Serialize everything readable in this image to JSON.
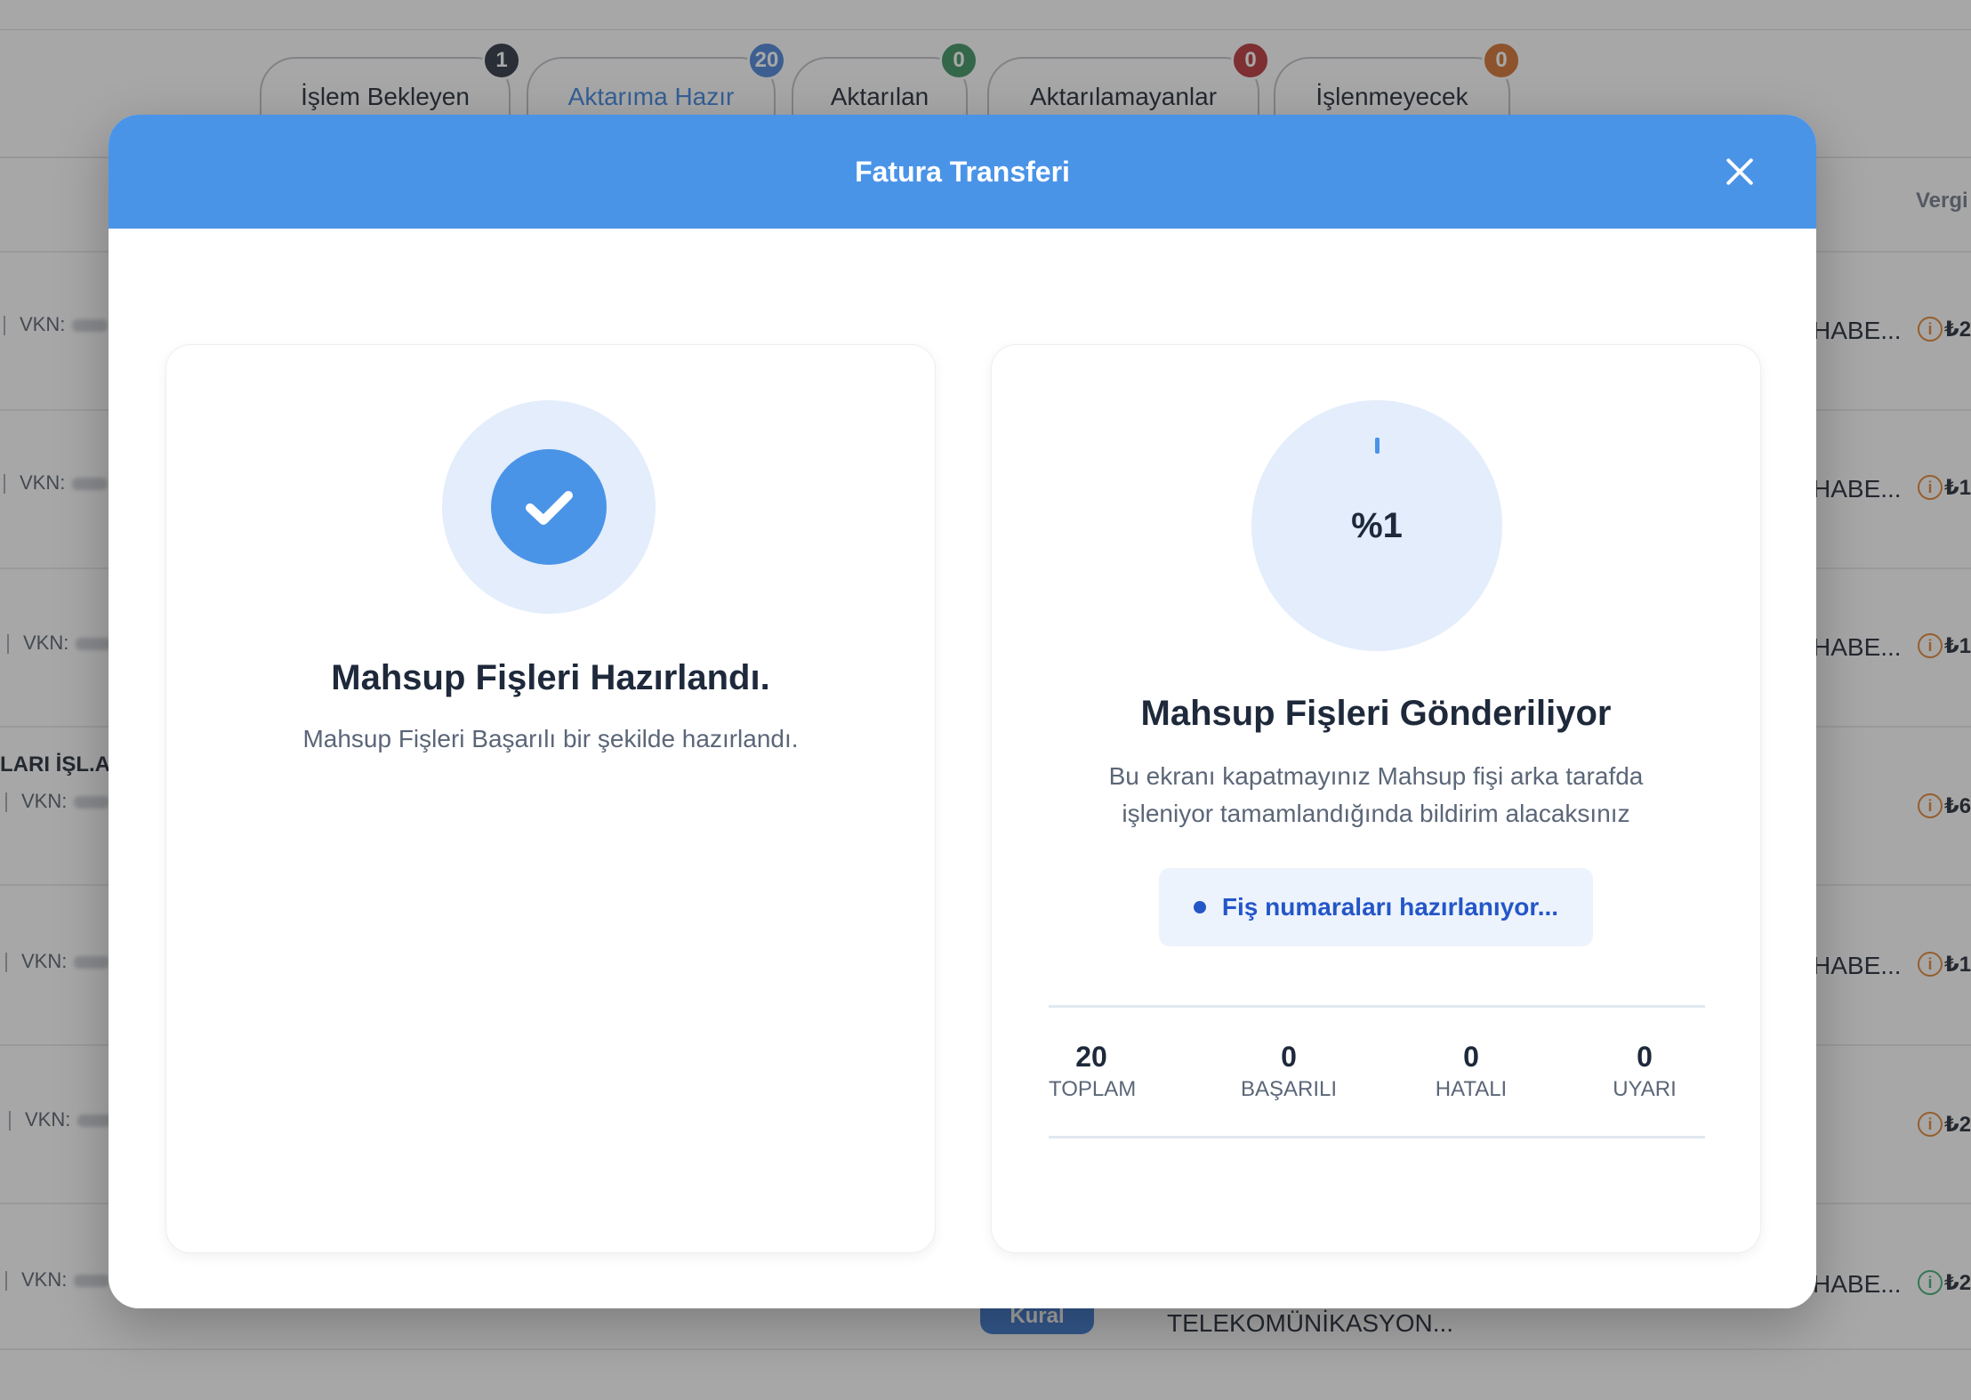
{
  "tabs": [
    {
      "label": "İşlem Bekleyen",
      "count": "1",
      "color": "#1b2433"
    },
    {
      "label": "Aktarıma Hazır",
      "count": "20",
      "color": "#3d7bd6"
    },
    {
      "label": "Aktarılan",
      "count": "0",
      "color": "#2e8b57"
    },
    {
      "label": "Aktarılamayanlar",
      "count": "0",
      "color": "#b3262b"
    },
    {
      "label": "İşlenmeyecek",
      "count": "0",
      "color": "#d0661f"
    }
  ],
  "background": {
    "column_header": "Vergi",
    "vkn_label": "VKN:",
    "company_partial": "LARI İŞL.A.",
    "habe_text": "HABE...",
    "amounts": [
      "₺2",
      "₺1",
      "₺1",
      "₺6",
      "₺1",
      "₺2",
      "₺2"
    ],
    "kural_label": "Kural",
    "telekom_text": "TELEKOMÜNİKASYON..."
  },
  "modal": {
    "title": "Fatura Transferi",
    "left_card": {
      "title": "Mahsup Fişleri Hazırlandı.",
      "description": "Mahsup Fişleri Başarılı bir şekilde hazırlandı."
    },
    "right_card": {
      "progress_text": "%1",
      "progress_value": 1,
      "title": "Mahsup Fişleri Gönderiliyor",
      "description_line1": "Bu ekranı kapatmayınız Mahsup fişi arka tarafda",
      "description_line2": "işleniyor tamamlandığında bildirim alacaksınız",
      "status": "Fiş numaraları hazırlanıyor...",
      "stats": [
        {
          "value": "20",
          "label": "TOPLAM"
        },
        {
          "value": "0",
          "label": "BAŞARILI"
        },
        {
          "value": "0",
          "label": "HATALI"
        },
        {
          "value": "0",
          "label": "UYARI"
        }
      ]
    }
  },
  "colors": {
    "accent": "#4a94e8",
    "status_text": "#2456c8"
  }
}
